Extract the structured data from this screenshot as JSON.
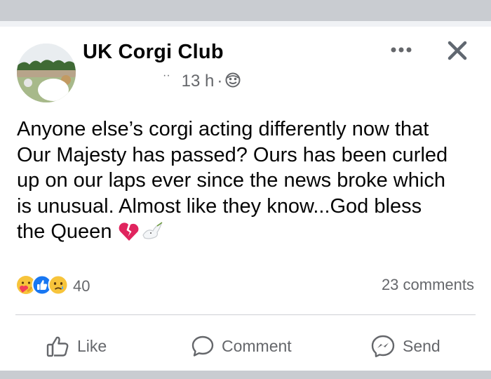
{
  "post": {
    "page_name": "UK Corgi Club",
    "ticks": "··",
    "timestamp": "13 h",
    "separator": "·",
    "audience_icon": "globe-icon",
    "text": "Anyone else’s corgi acting differently now that\nOur Majesty has passed? Ours has been curled\nup on our laps ever since the news broke which\nis unusual. Almost like they know...God bless\nthe Queen",
    "trailing_emoji": [
      "broken-heart-icon",
      "dove-icon"
    ]
  },
  "reactions": {
    "icons": [
      "care-icon",
      "like-icon",
      "sad-icon"
    ],
    "count": "40",
    "comments": "23 comments"
  },
  "actions": {
    "like": "Like",
    "comment": "Comment",
    "send": "Send"
  },
  "colors": {
    "text": "#050505",
    "secondary": "#65676b",
    "like_blue": "#1877f2",
    "broken_heart": "#e0245e",
    "reaction_yellow": "#f7c43b",
    "bar_grey": "#c9ccd1"
  }
}
